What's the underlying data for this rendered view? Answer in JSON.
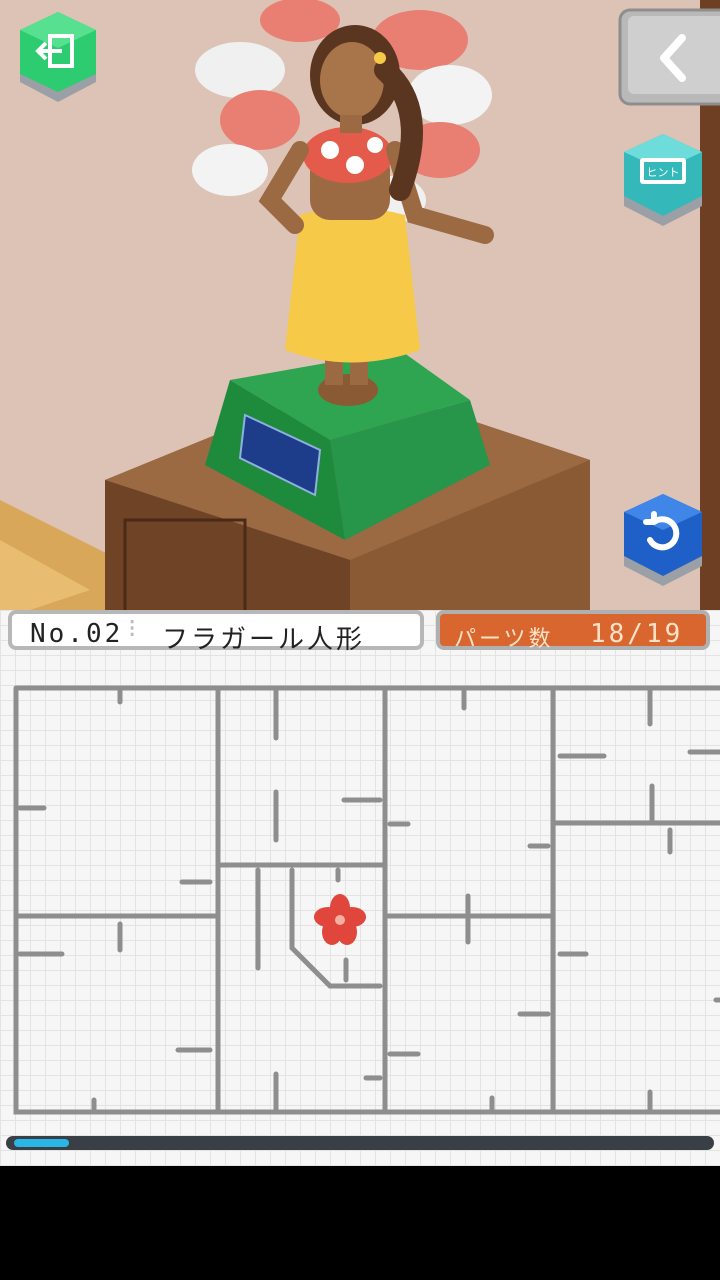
{
  "header": {
    "number_label": "No.02",
    "title": "フラガール人形",
    "parts_label": "パーツ数",
    "parts_count": "18/19",
    "hint_label": "ヒント"
  },
  "progress": {
    "fraction": 0.08
  },
  "icons": {
    "exit": "exit-icon",
    "back": "chevron-left-icon",
    "hint": "hint-icon",
    "undo": "undo-icon",
    "piece": "hibiscus-icon"
  },
  "colors": {
    "parts_tab": "#d8662e",
    "exit_button": "#2ecc71",
    "hint_button": "#3cc6c8",
    "undo_button": "#1f5fc8",
    "progress_fill": "#29b6e6"
  }
}
